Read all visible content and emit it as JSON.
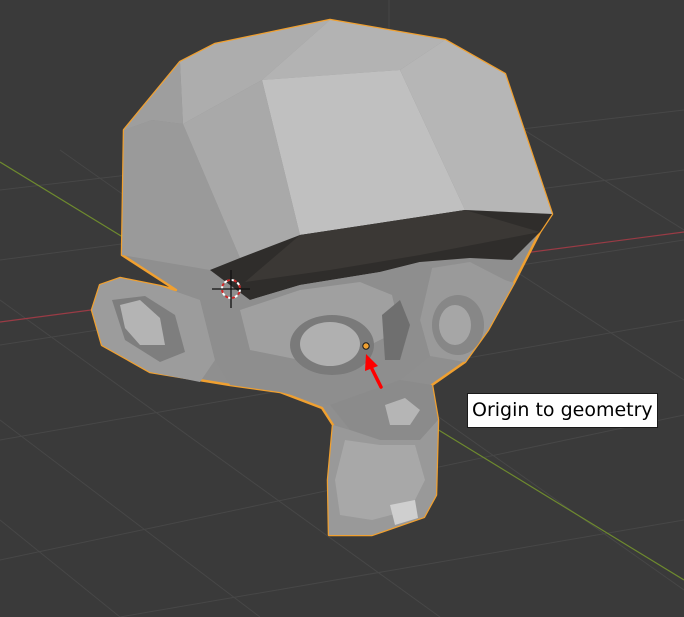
{
  "viewport": {
    "background": "#3a3a3a",
    "grid_color": "#474747",
    "x_axis_color": "#9a3b45",
    "y_axis_color": "#6e8a2e",
    "selection_outline_color": "#f0a030",
    "origin_dot_color": "#f0a030",
    "object": "monkey-mesh",
    "object_state": "selected"
  },
  "annotation": {
    "label": "Origin to geometry",
    "arrow_color": "#ff0000"
  }
}
